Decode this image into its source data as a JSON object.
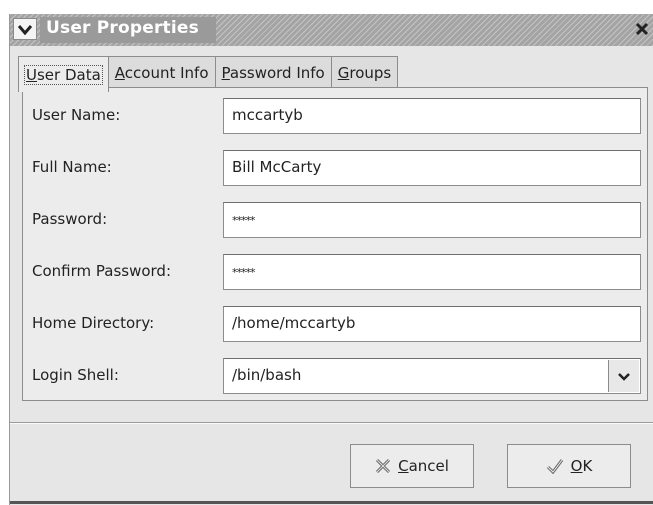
{
  "window": {
    "title": "User Properties",
    "menu_icon": "chevron-down-icon",
    "close_icon": "close-icon"
  },
  "tabs": [
    {
      "underline": "U",
      "rest": "ser Data",
      "active": true
    },
    {
      "underline": "A",
      "rest": "ccount Info",
      "active": false
    },
    {
      "underline": "P",
      "rest": "assword Info",
      "active": false
    },
    {
      "underline": "G",
      "rest": "roups",
      "active": false
    }
  ],
  "form": {
    "user_name": {
      "label": "User Name:",
      "value": "mccartyb"
    },
    "full_name": {
      "label": "Full Name:",
      "value": "Bill McCarty"
    },
    "password": {
      "label": "Password:",
      "value": "*****"
    },
    "confirm_password": {
      "label": "Confirm Password:",
      "value": "*****"
    },
    "home_directory": {
      "label": "Home Directory:",
      "value": "/home/mccartyb"
    },
    "login_shell": {
      "label": "Login Shell:",
      "value": "/bin/bash"
    }
  },
  "buttons": {
    "cancel": {
      "underline": "C",
      "rest": "ancel",
      "icon": "cancel-x-icon"
    },
    "ok": {
      "underline": "O",
      "rest": "K",
      "icon": "checkmark-icon"
    }
  }
}
